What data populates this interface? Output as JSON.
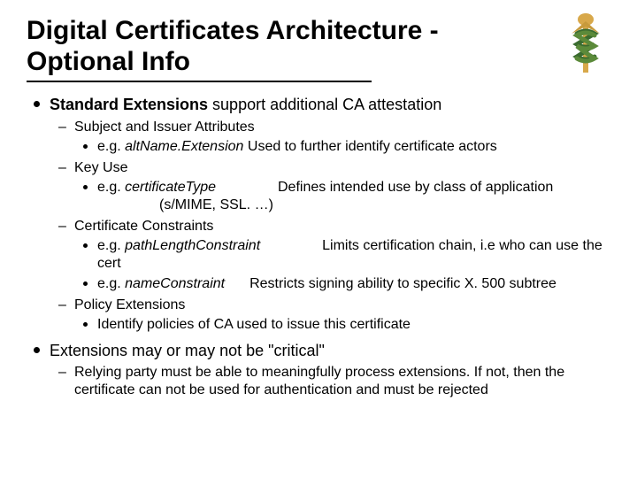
{
  "title": "Digital Certificates Architecture - Optional Info",
  "b1": {
    "lead": "Standard Extensions",
    "tail": " support additional CA attestation",
    "s1_head": "Subject and Issuer Attributes",
    "s1_eg": "e.g.  ",
    "s1_term": "altName.Extension",
    "s1_desc": "   Used to further identify certificate actors",
    "s2_head": "Key Use",
    "s2_eg": "e.g. ",
    "s2_term": "certificateType",
    "s2_desc_a": "Defines  intended use by class of application",
    "s2_desc_b": "(s/MIME, SSL. …)",
    "s3_head": "Certificate Constraints",
    "s3a_eg": "e.g. ",
    "s3a_term": "pathLengthConstraint",
    "s3a_desc": "Limits certification chain, i.e who can use the cert",
    "s3b_eg": "e.g. ",
    "s3b_term": "nameConstraint",
    "s3b_desc": "Restricts signing ability to specific X. 500 subtree",
    "s4_head": "Policy Extensions",
    "s4_desc": "Identify policies of CA  used to issue this certificate"
  },
  "b2": {
    "text": "Extensions may or may not be \"critical\"",
    "sub": "Relying party must be able to meaningfully process extensions. If not, then the certificate can not be used for authentication and must be rejected"
  }
}
